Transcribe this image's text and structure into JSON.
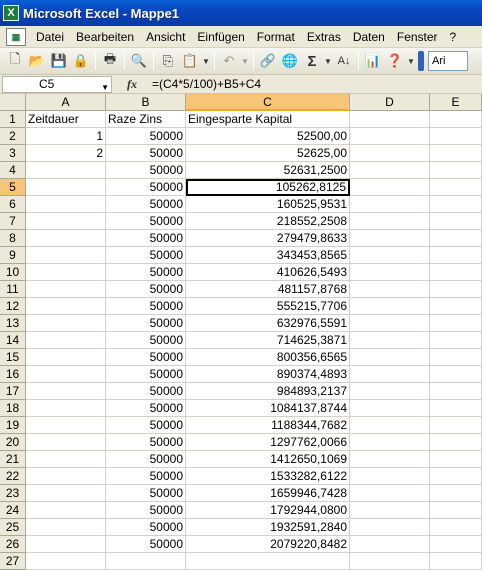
{
  "window": {
    "title": "Microsoft Excel - Mappe1",
    "app_icon": "X"
  },
  "menu": [
    "Datei",
    "Bearbeiten",
    "Ansicht",
    "Einfügen",
    "Format",
    "Extras",
    "Daten",
    "Fenster",
    "?"
  ],
  "toolbar": {
    "font_value": "Ari"
  },
  "formula_bar": {
    "cell_ref": "C5",
    "fx": "fx",
    "formula": "=(C4*5/100)+B5+C4"
  },
  "columns": [
    "A",
    "B",
    "C",
    "D",
    "E"
  ],
  "active_cell": {
    "col": "C",
    "row": 5
  },
  "rows": [
    {
      "n": "1",
      "a": "Zeitdauer",
      "b": "Raze Zins",
      "c": "Eingesparte Kapital"
    },
    {
      "n": "2",
      "a": "1",
      "b": "50000",
      "c": "52500,00"
    },
    {
      "n": "3",
      "a": "2",
      "b": "50000",
      "c": "52625,00"
    },
    {
      "n": "4",
      "a": "",
      "b": "50000",
      "c": "52631,2500"
    },
    {
      "n": "5",
      "a": "",
      "b": "50000",
      "c": "105262,8125"
    },
    {
      "n": "6",
      "a": "",
      "b": "50000",
      "c": "160525,9531"
    },
    {
      "n": "7",
      "a": "",
      "b": "50000",
      "c": "218552,2508"
    },
    {
      "n": "8",
      "a": "",
      "b": "50000",
      "c": "279479,8633"
    },
    {
      "n": "9",
      "a": "",
      "b": "50000",
      "c": "343453,8565"
    },
    {
      "n": "10",
      "a": "",
      "b": "50000",
      "c": "410626,5493"
    },
    {
      "n": "11",
      "a": "",
      "b": "50000",
      "c": "481157,8768"
    },
    {
      "n": "12",
      "a": "",
      "b": "50000",
      "c": "555215,7706"
    },
    {
      "n": "13",
      "a": "",
      "b": "50000",
      "c": "632976,5591"
    },
    {
      "n": "14",
      "a": "",
      "b": "50000",
      "c": "714625,3871"
    },
    {
      "n": "15",
      "a": "",
      "b": "50000",
      "c": "800356,6565"
    },
    {
      "n": "16",
      "a": "",
      "b": "50000",
      "c": "890374,4893"
    },
    {
      "n": "17",
      "a": "",
      "b": "50000",
      "c": "984893,2137"
    },
    {
      "n": "18",
      "a": "",
      "b": "50000",
      "c": "1084137,8744"
    },
    {
      "n": "19",
      "a": "",
      "b": "50000",
      "c": "1188344,7682"
    },
    {
      "n": "20",
      "a": "",
      "b": "50000",
      "c": "1297762,0066"
    },
    {
      "n": "21",
      "a": "",
      "b": "50000",
      "c": "1412650,1069"
    },
    {
      "n": "22",
      "a": "",
      "b": "50000",
      "c": "1533282,6122"
    },
    {
      "n": "23",
      "a": "",
      "b": "50000",
      "c": "1659946,7428"
    },
    {
      "n": "24",
      "a": "",
      "b": "50000",
      "c": "1792944,0800"
    },
    {
      "n": "25",
      "a": "",
      "b": "50000",
      "c": "1932591,2840"
    },
    {
      "n": "26",
      "a": "",
      "b": "50000",
      "c": "2079220,8482"
    },
    {
      "n": "27",
      "a": "",
      "b": "",
      "c": ""
    }
  ]
}
